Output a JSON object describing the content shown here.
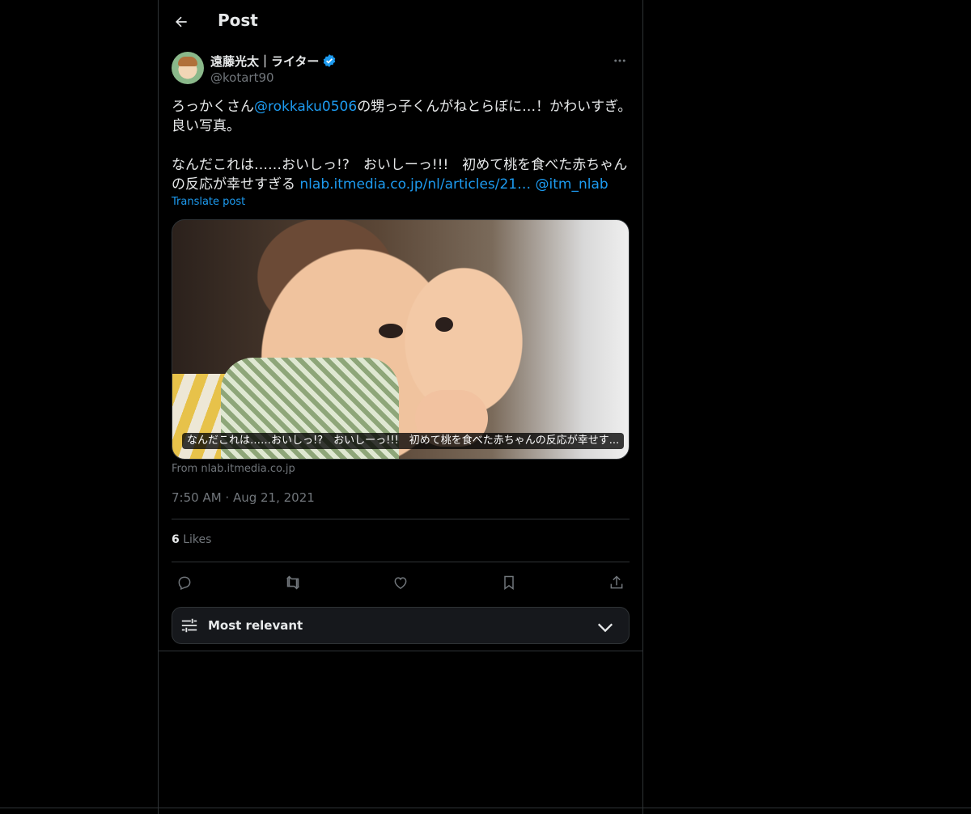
{
  "header": {
    "title": "Post",
    "back_icon": "arrow-left-icon"
  },
  "author": {
    "display_name": "遠藤光太｜ライター",
    "handle": "@kotart90",
    "verified": true,
    "more_icon": "more-horizontal-icon"
  },
  "tweet": {
    "line1_prefix": "ろっかくさん",
    "mention1": "@rokkaku0506",
    "line1_suffix": "の甥っ子くんがねとらぼに…！かわいすぎ。",
    "line2": "良い写真。",
    "line4": "なんだこれは……おいしっ!?　おいしーっ!!!　初めて桃を食べた赤ちゃん",
    "line5_prefix": "の反応が幸せすぎる ",
    "link": "nlab.itmedia.co.jp/nl/articles/21…",
    "mention2": "@itm_nlab",
    "translate_label": "Translate post"
  },
  "media": {
    "caption": "なんだこれは……おいしっ!?　おいしーっ!!!　初めて桃を食べた赤ちゃんの反応が幸せす...",
    "source": "From nlab.itmedia.co.jp"
  },
  "meta": {
    "timestamp": "7:50 AM · Aug 21, 2021",
    "likes_count": "6",
    "likes_label": "Likes"
  },
  "actions": [
    {
      "name": "reply",
      "icon": "reply-icon"
    },
    {
      "name": "repost",
      "icon": "repost-icon"
    },
    {
      "name": "like",
      "icon": "heart-icon"
    },
    {
      "name": "bookmark",
      "icon": "bookmark-icon"
    },
    {
      "name": "share",
      "icon": "share-icon"
    }
  ],
  "sort": {
    "label": "Most relevant",
    "icon": "sliders-icon",
    "chevron": "chevron-down-icon"
  },
  "colors": {
    "background": "#000000",
    "text": "#e7e9ea",
    "muted": "#71767b",
    "accent": "#1d9bf0",
    "border": "#2f3336"
  }
}
